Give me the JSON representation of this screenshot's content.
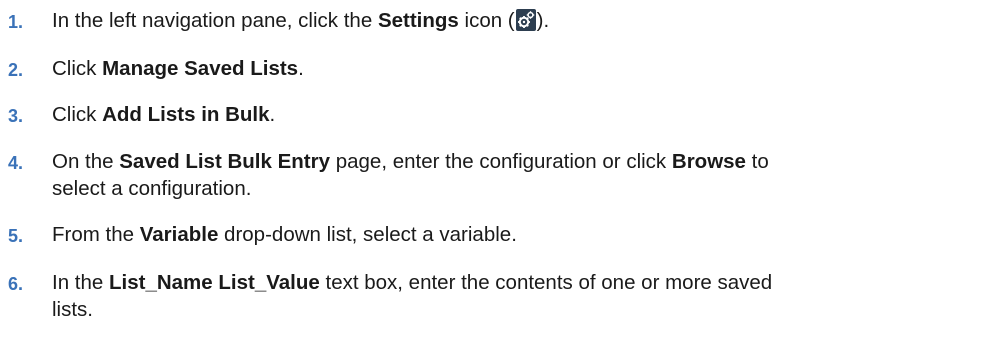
{
  "icons": {
    "settings": "gears-icon",
    "icon_bg": "#2d3e50",
    "icon_fg": "#ffffff"
  },
  "colors": {
    "step_number": "#3a72b8",
    "text": "#1a1a1a"
  },
  "steps": [
    {
      "number": "1.",
      "parts": [
        "In the left navigation pane, click the ",
        "Settings",
        " icon (",
        ")."
      ]
    },
    {
      "number": "2.",
      "parts": [
        "Click ",
        "Manage Saved Lists",
        "."
      ]
    },
    {
      "number": "3.",
      "parts": [
        "Click ",
        "Add Lists in Bulk",
        "."
      ]
    },
    {
      "number": "4.",
      "parts": [
        "On the ",
        "Saved List Bulk Entry",
        " page, enter the configuration or click ",
        "Browse",
        " to",
        "select a configuration."
      ]
    },
    {
      "number": "5.",
      "parts": [
        "From the ",
        "Variable",
        " drop-down list, select a variable."
      ]
    },
    {
      "number": "6.",
      "parts": [
        "In the ",
        "List_Name List_Value",
        " text box, enter the contents of one or more saved",
        "lists."
      ]
    }
  ]
}
